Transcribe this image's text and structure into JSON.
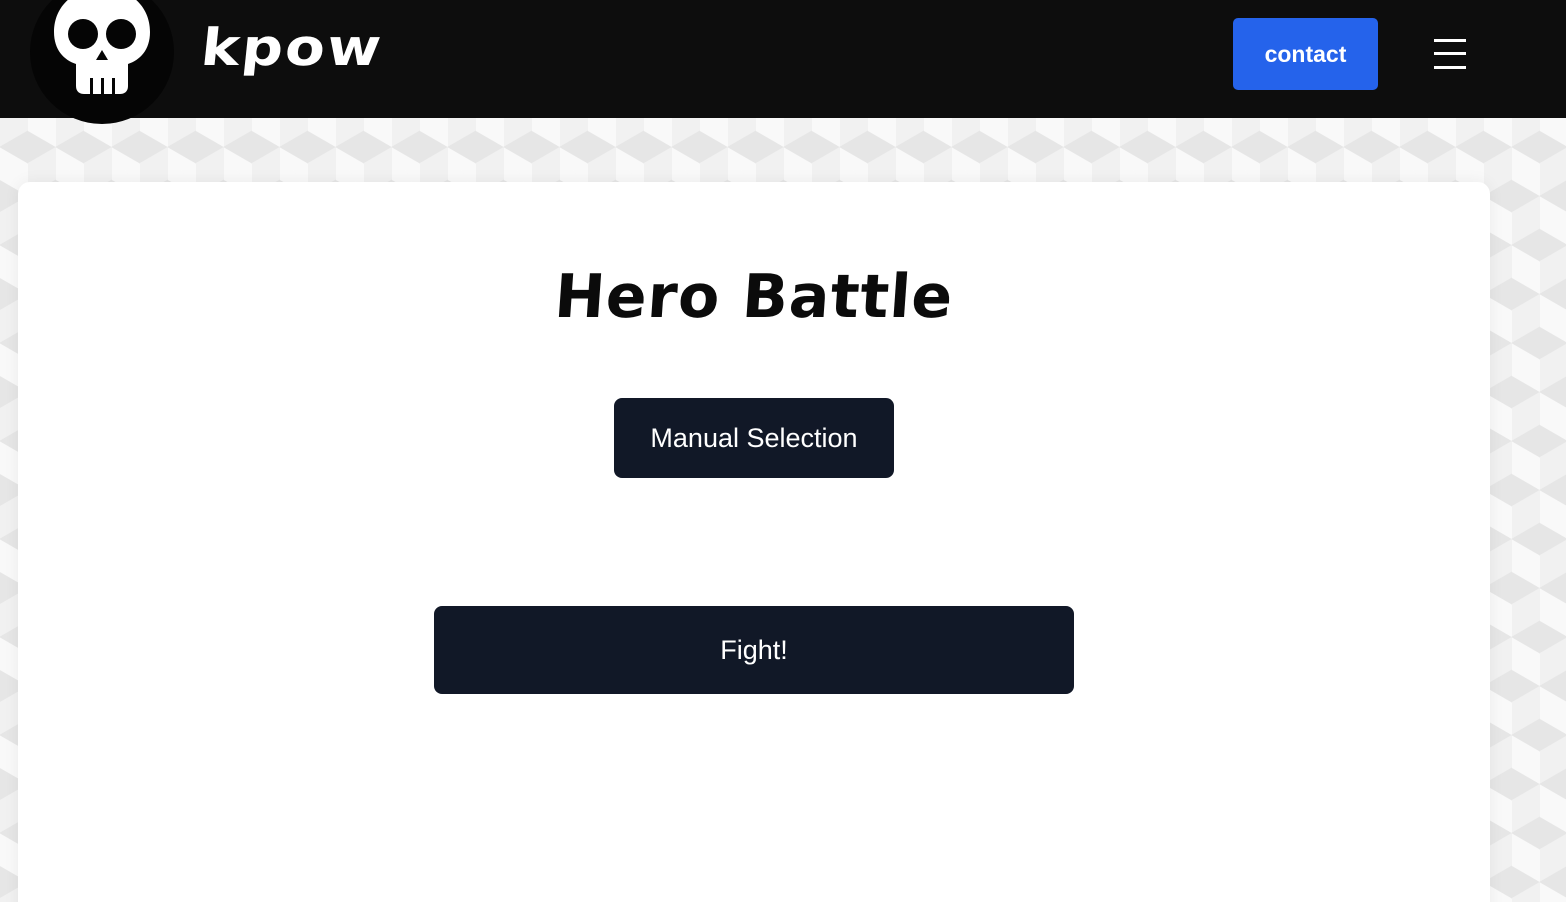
{
  "header": {
    "brand": "kpow",
    "logo_icon": "skull-icon",
    "contact_label": "contact",
    "menu_icon": "hamburger-menu-icon"
  },
  "main": {
    "title": "Hero Battle",
    "manual_selection_label": "Manual Selection",
    "fight_label": "Fight!"
  },
  "colors": {
    "header_bg": "#0d0d0d",
    "accent": "#2563eb",
    "button_dark": "#111827",
    "card_bg": "#ffffff"
  }
}
